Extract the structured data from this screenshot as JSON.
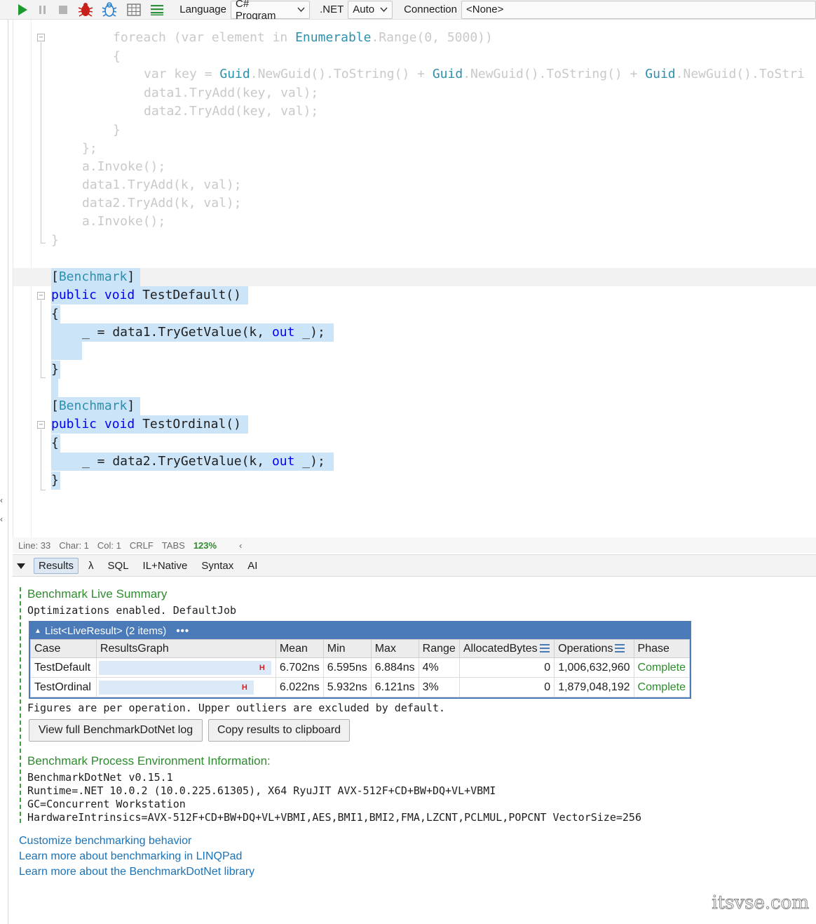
{
  "toolbar": {
    "language_label": "Language",
    "language_value": "C# Program",
    "dotnet_label": ".NET",
    "dotnet_value": "Auto",
    "connection_label": "Connection",
    "connection_value": "<None>"
  },
  "code": {
    "faded": [
      "foreach (var element in Enumerable.Range(0, 5000))",
      "{",
      "var key = Guid.NewGuid().ToString() + Guid.NewGuid().ToString() + Guid.NewGuid().ToStri",
      "data1.TryAdd(key, val);",
      "data2.TryAdd(key, val);",
      "}",
      "};",
      "a.Invoke();",
      "data1.TryAdd(k, val);",
      "data2.TryAdd(k, val);",
      "a.Invoke();",
      "}"
    ],
    "attr1": "[Benchmark]",
    "m1_sig": "public void TestDefault()",
    "m1_open": "{",
    "m1_body": "_ = data1.TryGetValue(k, out _);",
    "m1_close": "}",
    "attr2": "[Benchmark]",
    "m2_sig": "public void TestOrdinal()",
    "m2_open": "{",
    "m2_body": "_ = data2.TryGetValue(k, out _);",
    "m2_close": "}"
  },
  "statusbar": {
    "line": "Line: 33",
    "char": "Char: 1",
    "col": "Col: 1",
    "eol": "CRLF",
    "indent": "TABS",
    "zoom": "123%"
  },
  "result_tabs": [
    "Results",
    "λ",
    "SQL",
    "IL+Native",
    "Syntax",
    "AI"
  ],
  "results": {
    "live_title": "Benchmark Live Summary",
    "live_subtitle": "Optimizations enabled. DefaultJob",
    "table_title": "List<LiveResult> (2 items)",
    "table_more": "•••",
    "columns": [
      "Case",
      "ResultsGraph",
      "Mean",
      "Min",
      "Max",
      "Range",
      "AllocatedBytes",
      "Operations",
      "Phase"
    ],
    "rows": [
      {
        "case": "TestDefault",
        "mean": "6.702ns",
        "min": "6.595ns",
        "max": "6.884ns",
        "range": "4%",
        "alloc": "0",
        "ops": "1,006,632,960",
        "phase": "Complete",
        "graph_fraction": 1.0
      },
      {
        "case": "TestOrdinal",
        "mean": "6.022ns",
        "min": "5.932ns",
        "max": "6.121ns",
        "range": "3%",
        "alloc": "0",
        "ops": "1,879,048,192",
        "phase": "Complete",
        "graph_fraction": 0.9
      }
    ],
    "footnote": "Figures are per operation. Upper outliers are excluded by default.",
    "btn_log": "View full BenchmarkDotNet log",
    "btn_copy": "Copy results to clipboard",
    "env_title": "Benchmark Process Environment Information:",
    "env_lines": [
      "BenchmarkDotNet v0.15.1",
      "Runtime=.NET 10.0.2 (10.0.225.61305), X64 RyuJIT AVX-512F+CD+BW+DQ+VL+VBMI",
      "GC=Concurrent Workstation",
      "HardwareIntrinsics=AVX-512F+CD+BW+DQ+VL+VBMI,AES,BMI1,BMI2,FMA,LZCNT,PCLMUL,POPCNT VectorSize=256"
    ],
    "links": [
      "Customize benchmarking behavior",
      "Learn more about benchmarking in LINQPad",
      "Learn more about the BenchmarkDotNet library"
    ]
  },
  "watermark": "itsvse.com",
  "colors": {
    "accent_green": "#2e8b2e",
    "table_header_blue": "#4a7ab8",
    "selection": "#cce4f7",
    "link": "#1a73b8",
    "whisker_red": "#d62020"
  }
}
